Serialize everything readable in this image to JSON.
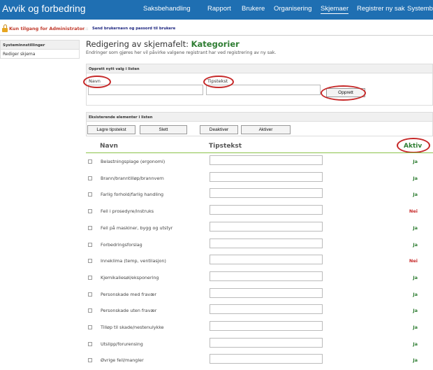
{
  "app": {
    "title": "Avvik og forbedring"
  },
  "nav": [
    {
      "label": "Saksbehandling",
      "active": false
    },
    {
      "label": "Rapport",
      "active": false
    },
    {
      "label": "Brukere",
      "active": false
    },
    {
      "label": "Organisering",
      "active": false
    },
    {
      "label": "Skjemaer",
      "active": true
    },
    {
      "label": "Registrer ny sak",
      "active": false
    },
    {
      "label": "Systembruker",
      "active": false
    }
  ],
  "admin": {
    "text": "Kun tilgang for Administrator",
    "separator": ":::",
    "link": "Send brukernavn og passord til brukere"
  },
  "sidebar": {
    "title": "Systeminnstillinger",
    "items": [
      {
        "label": "Rediger skjema"
      }
    ]
  },
  "page": {
    "title_prefix": "Redigering av skjemafelt:",
    "title_field": "Kategorier",
    "subtitle": "Endringer som gjøres her vil påvirke valgene registrant har ved registrering av ny sak."
  },
  "create_panel": {
    "title": "Opprett nytt valg i listen",
    "name_label": "Navn",
    "name_value": "",
    "tip_label": "Tipstekst",
    "tip_value": "",
    "create_button": "Opprett"
  },
  "list_panel": {
    "title": "Eksisterende elementer i listen",
    "buttons": {
      "save_tips": "Lagre tipstekst",
      "delete": "Slett",
      "deactivate": "Deaktiver",
      "activate": "Aktiver"
    },
    "columns": {
      "name": "Navn",
      "tip": "Tipstekst",
      "active": "Aktiv"
    },
    "rows": [
      {
        "name": "Belastningsplage (ergonomi)",
        "tip": "",
        "active": "Ja"
      },
      {
        "name": "Brann/branntilløp/brannvern",
        "tip": "",
        "active": "Ja"
      },
      {
        "name": "Farlig forhold/farlig handling",
        "tip": "",
        "active": "Ja"
      },
      {
        "name": "Feil i prosedyre/instruks",
        "tip": "",
        "active": "Nei"
      },
      {
        "name": "Feil på maskiner, bygg og utstyr",
        "tip": "",
        "active": "Ja"
      },
      {
        "name": "Forbedringsforslag",
        "tip": "",
        "active": "Ja"
      },
      {
        "name": "Inneklima (temp, ventilasjon)",
        "tip": "",
        "active": "Nei"
      },
      {
        "name": "Kjemikaliesøl/eksponering",
        "tip": "",
        "active": "Ja"
      },
      {
        "name": "Personskade med fravær",
        "tip": "",
        "active": "Ja"
      },
      {
        "name": "Personskade uten fravær",
        "tip": "",
        "active": "Ja"
      },
      {
        "name": "Tilløp til skade/nestenulykke",
        "tip": "",
        "active": "Ja"
      },
      {
        "name": "Utslipp/forurensing",
        "tip": "",
        "active": "Ja"
      },
      {
        "name": "Øvrige feil/mangler",
        "tip": "",
        "active": "Ja"
      }
    ]
  },
  "colors": {
    "topbar": "#1f6fb2",
    "yes": "#2e7d32",
    "no": "#c62828",
    "highlight_ring": "#c62828"
  }
}
